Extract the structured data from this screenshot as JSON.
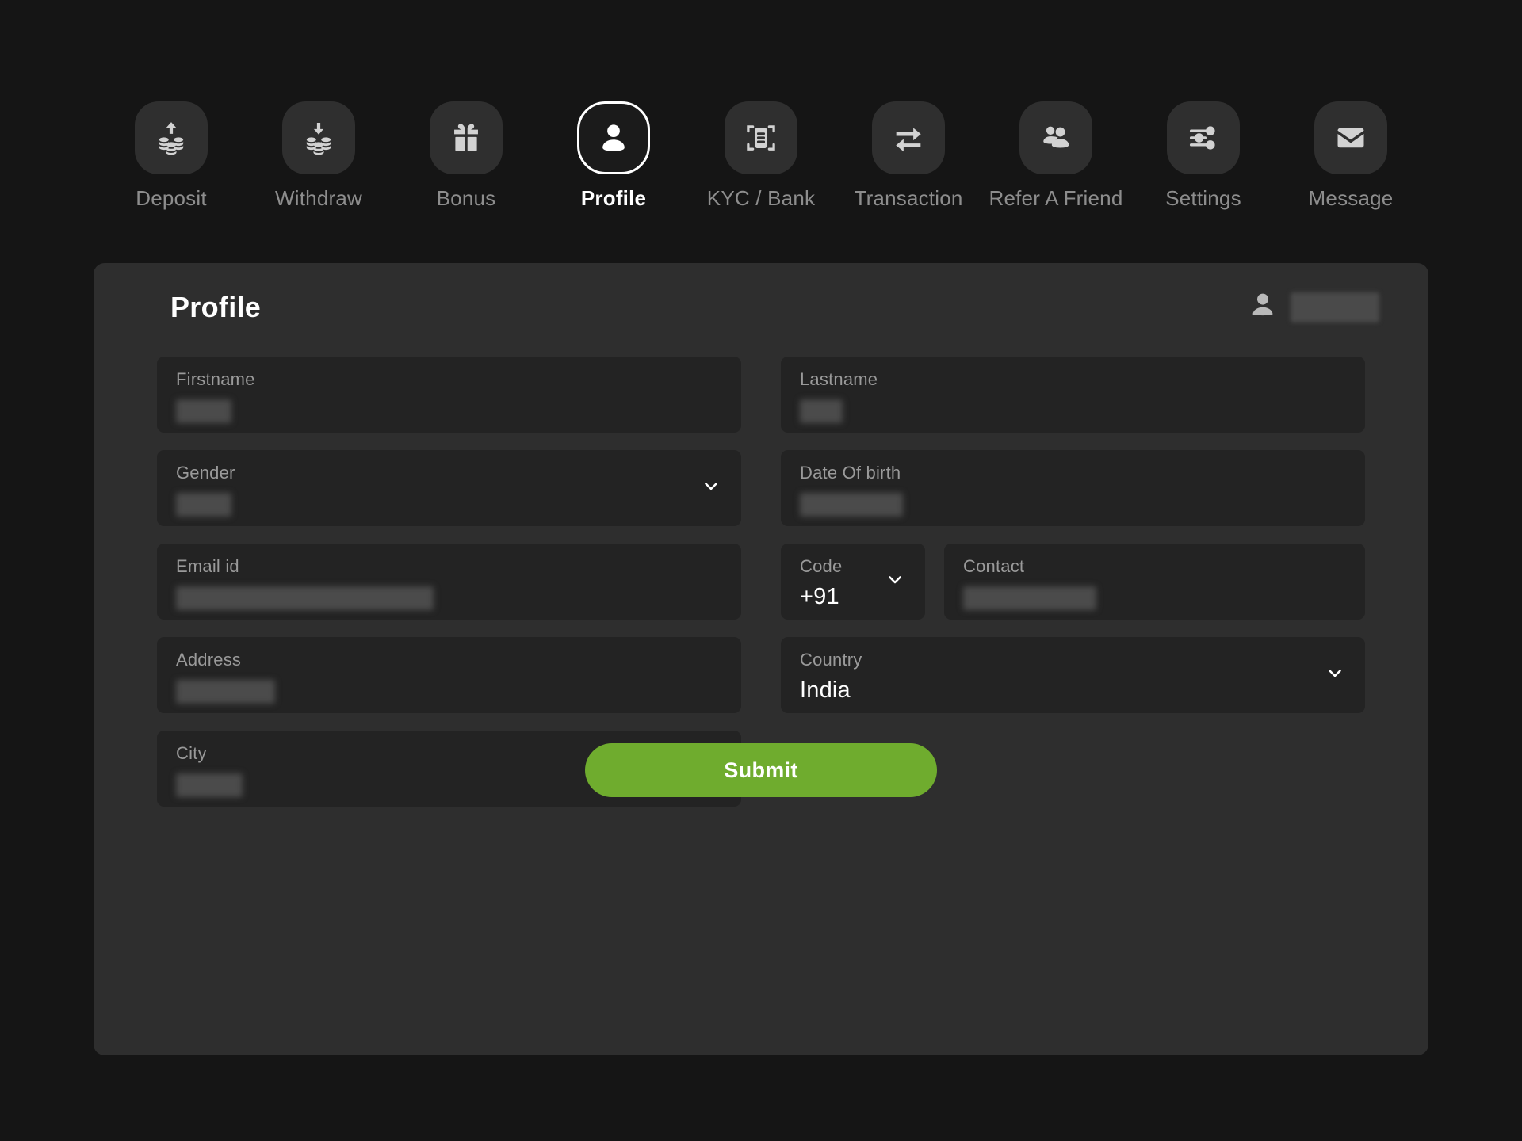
{
  "nav": {
    "items": [
      {
        "label": "Deposit",
        "icon": "deposit-coins-up-icon",
        "active": false
      },
      {
        "label": "Withdraw",
        "icon": "withdraw-coins-down-icon",
        "active": false
      },
      {
        "label": "Bonus",
        "icon": "gift-icon",
        "active": false
      },
      {
        "label": "Profile",
        "icon": "person-icon",
        "active": true
      },
      {
        "label": "KYC / Bank",
        "icon": "id-card-scan-icon",
        "active": false
      },
      {
        "label": "Transaction",
        "icon": "transfer-arrows-icon",
        "active": false
      },
      {
        "label": "Refer A Friend",
        "icon": "people-group-icon",
        "active": false
      },
      {
        "label": "Settings",
        "icon": "sliders-icon",
        "active": false
      },
      {
        "label": "Message",
        "icon": "envelope-icon",
        "active": false
      }
    ]
  },
  "card": {
    "title": "Profile",
    "user": {
      "avatar_icon": "person-avatar-icon",
      "username": ""
    }
  },
  "form": {
    "firstname": {
      "label": "Firstname",
      "value": ""
    },
    "lastname": {
      "label": "Lastname",
      "value": ""
    },
    "gender": {
      "label": "Gender",
      "value": ""
    },
    "dob": {
      "label": "Date Of birth",
      "value": ""
    },
    "email": {
      "label": "Email id",
      "value": ""
    },
    "code": {
      "label": "Code",
      "value": "+91"
    },
    "contact": {
      "label": "Contact",
      "value": ""
    },
    "address": {
      "label": "Address",
      "value": ""
    },
    "country": {
      "label": "Country",
      "value": "India"
    },
    "city": {
      "label": "City",
      "value": ""
    }
  },
  "actions": {
    "submit_label": "Submit"
  },
  "colors": {
    "page_bg": "#151515",
    "card_bg": "#2e2e2e",
    "field_bg": "#232323",
    "nav_tile_bg": "#2f2f2f",
    "accent_green": "#6fac2e",
    "label_gray": "#9a9a9a",
    "nav_label_gray": "#8d8d8d"
  }
}
